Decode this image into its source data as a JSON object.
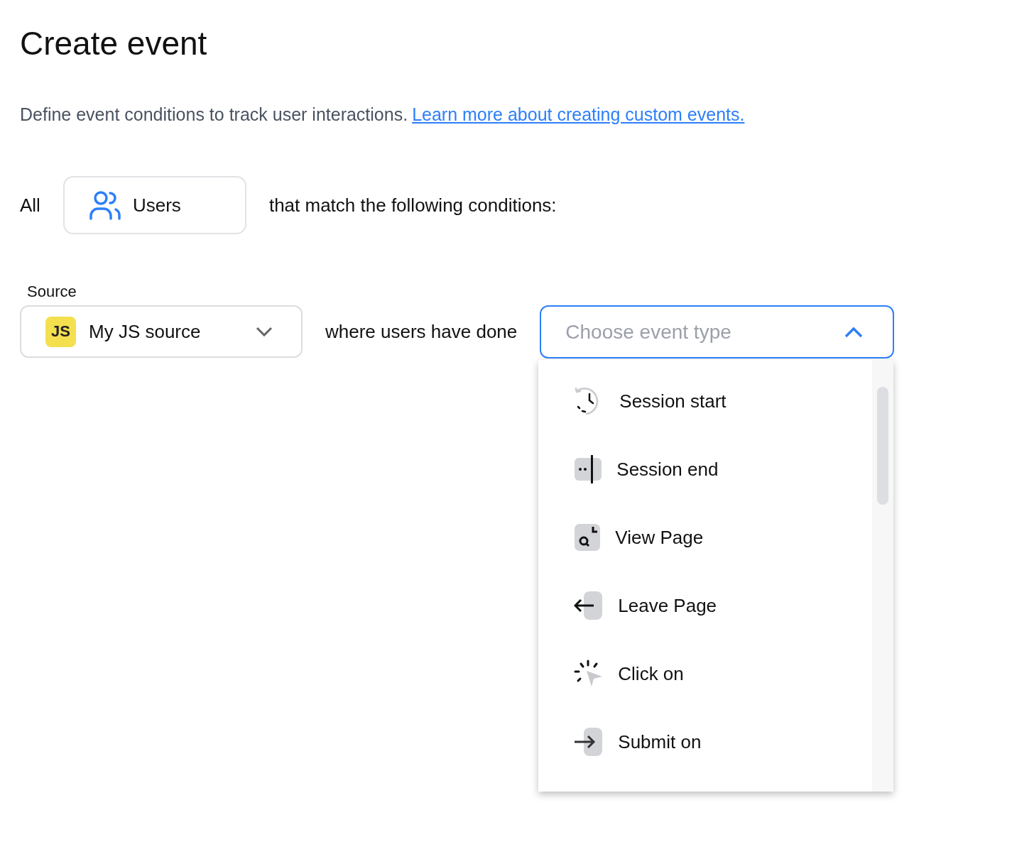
{
  "title": "Create event",
  "description": {
    "text": "Define event conditions to track user interactions.",
    "link": "Learn more about creating custom events."
  },
  "audience": {
    "prefix": "All",
    "entity": "Users",
    "suffix": "that match the following conditions:"
  },
  "source": {
    "label": "Source",
    "badge": "JS",
    "value": "My JS source"
  },
  "connector": "where users have done",
  "event_select": {
    "placeholder": "Choose event type",
    "expanded": true
  },
  "options": [
    {
      "label": "Session start",
      "kind": "session-start"
    },
    {
      "label": "Session end",
      "kind": "session-end"
    },
    {
      "label": "View Page",
      "kind": "view-page"
    },
    {
      "label": "Leave Page",
      "kind": "leave-page"
    },
    {
      "label": "Click on",
      "kind": "click"
    },
    {
      "label": "Submit on",
      "kind": "submit"
    }
  ]
}
